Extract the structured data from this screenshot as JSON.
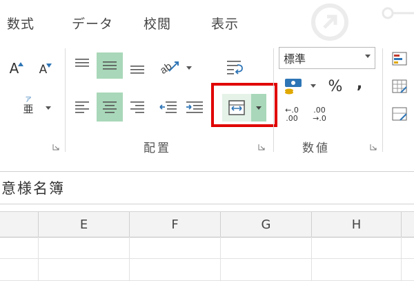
{
  "tabs": [
    {
      "label": "数式"
    },
    {
      "label": "データ"
    },
    {
      "label": "校閲"
    },
    {
      "label": "表示"
    }
  ],
  "ribbon": {
    "alignment_group_label": "配置",
    "number_group_label": "数値",
    "number_format": "標準",
    "percent_symbol": "%",
    "comma_symbol": ",",
    "increase_decimal": {
      "top": "←.0",
      "bottom": ".00"
    },
    "decrease_decimal": {
      "top": ".00",
      "bottom": "→.0"
    },
    "font_grow_label": "A",
    "font_shrink_label": "A",
    "phonetic_label": "亜"
  },
  "formula_bar": {
    "text": "意様名簿"
  },
  "columns": [
    "E",
    "F",
    "G",
    "H"
  ],
  "colors": {
    "selected_button": "#a8d8b9",
    "highlight_box": "#e00000",
    "accent_blue": "#2e75b6"
  }
}
